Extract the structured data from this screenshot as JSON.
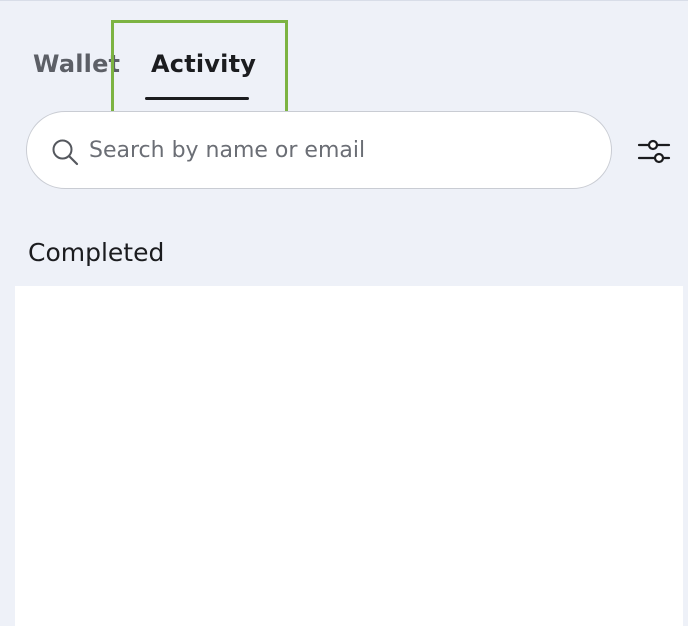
{
  "tabs": {
    "wallet_label": "Wallet",
    "activity_label": "Activity",
    "active_tab": "Activity"
  },
  "search": {
    "placeholder": "Search by name or email",
    "value": ""
  },
  "icons": {
    "search": "search-icon",
    "filter": "sliders-filter-icon"
  },
  "sections": {
    "completed_heading": "Completed"
  },
  "colors": {
    "background": "#eef1f8",
    "highlight": "#7cb342",
    "text_primary": "#1b1c1f",
    "text_secondary": "#5c5f66"
  }
}
